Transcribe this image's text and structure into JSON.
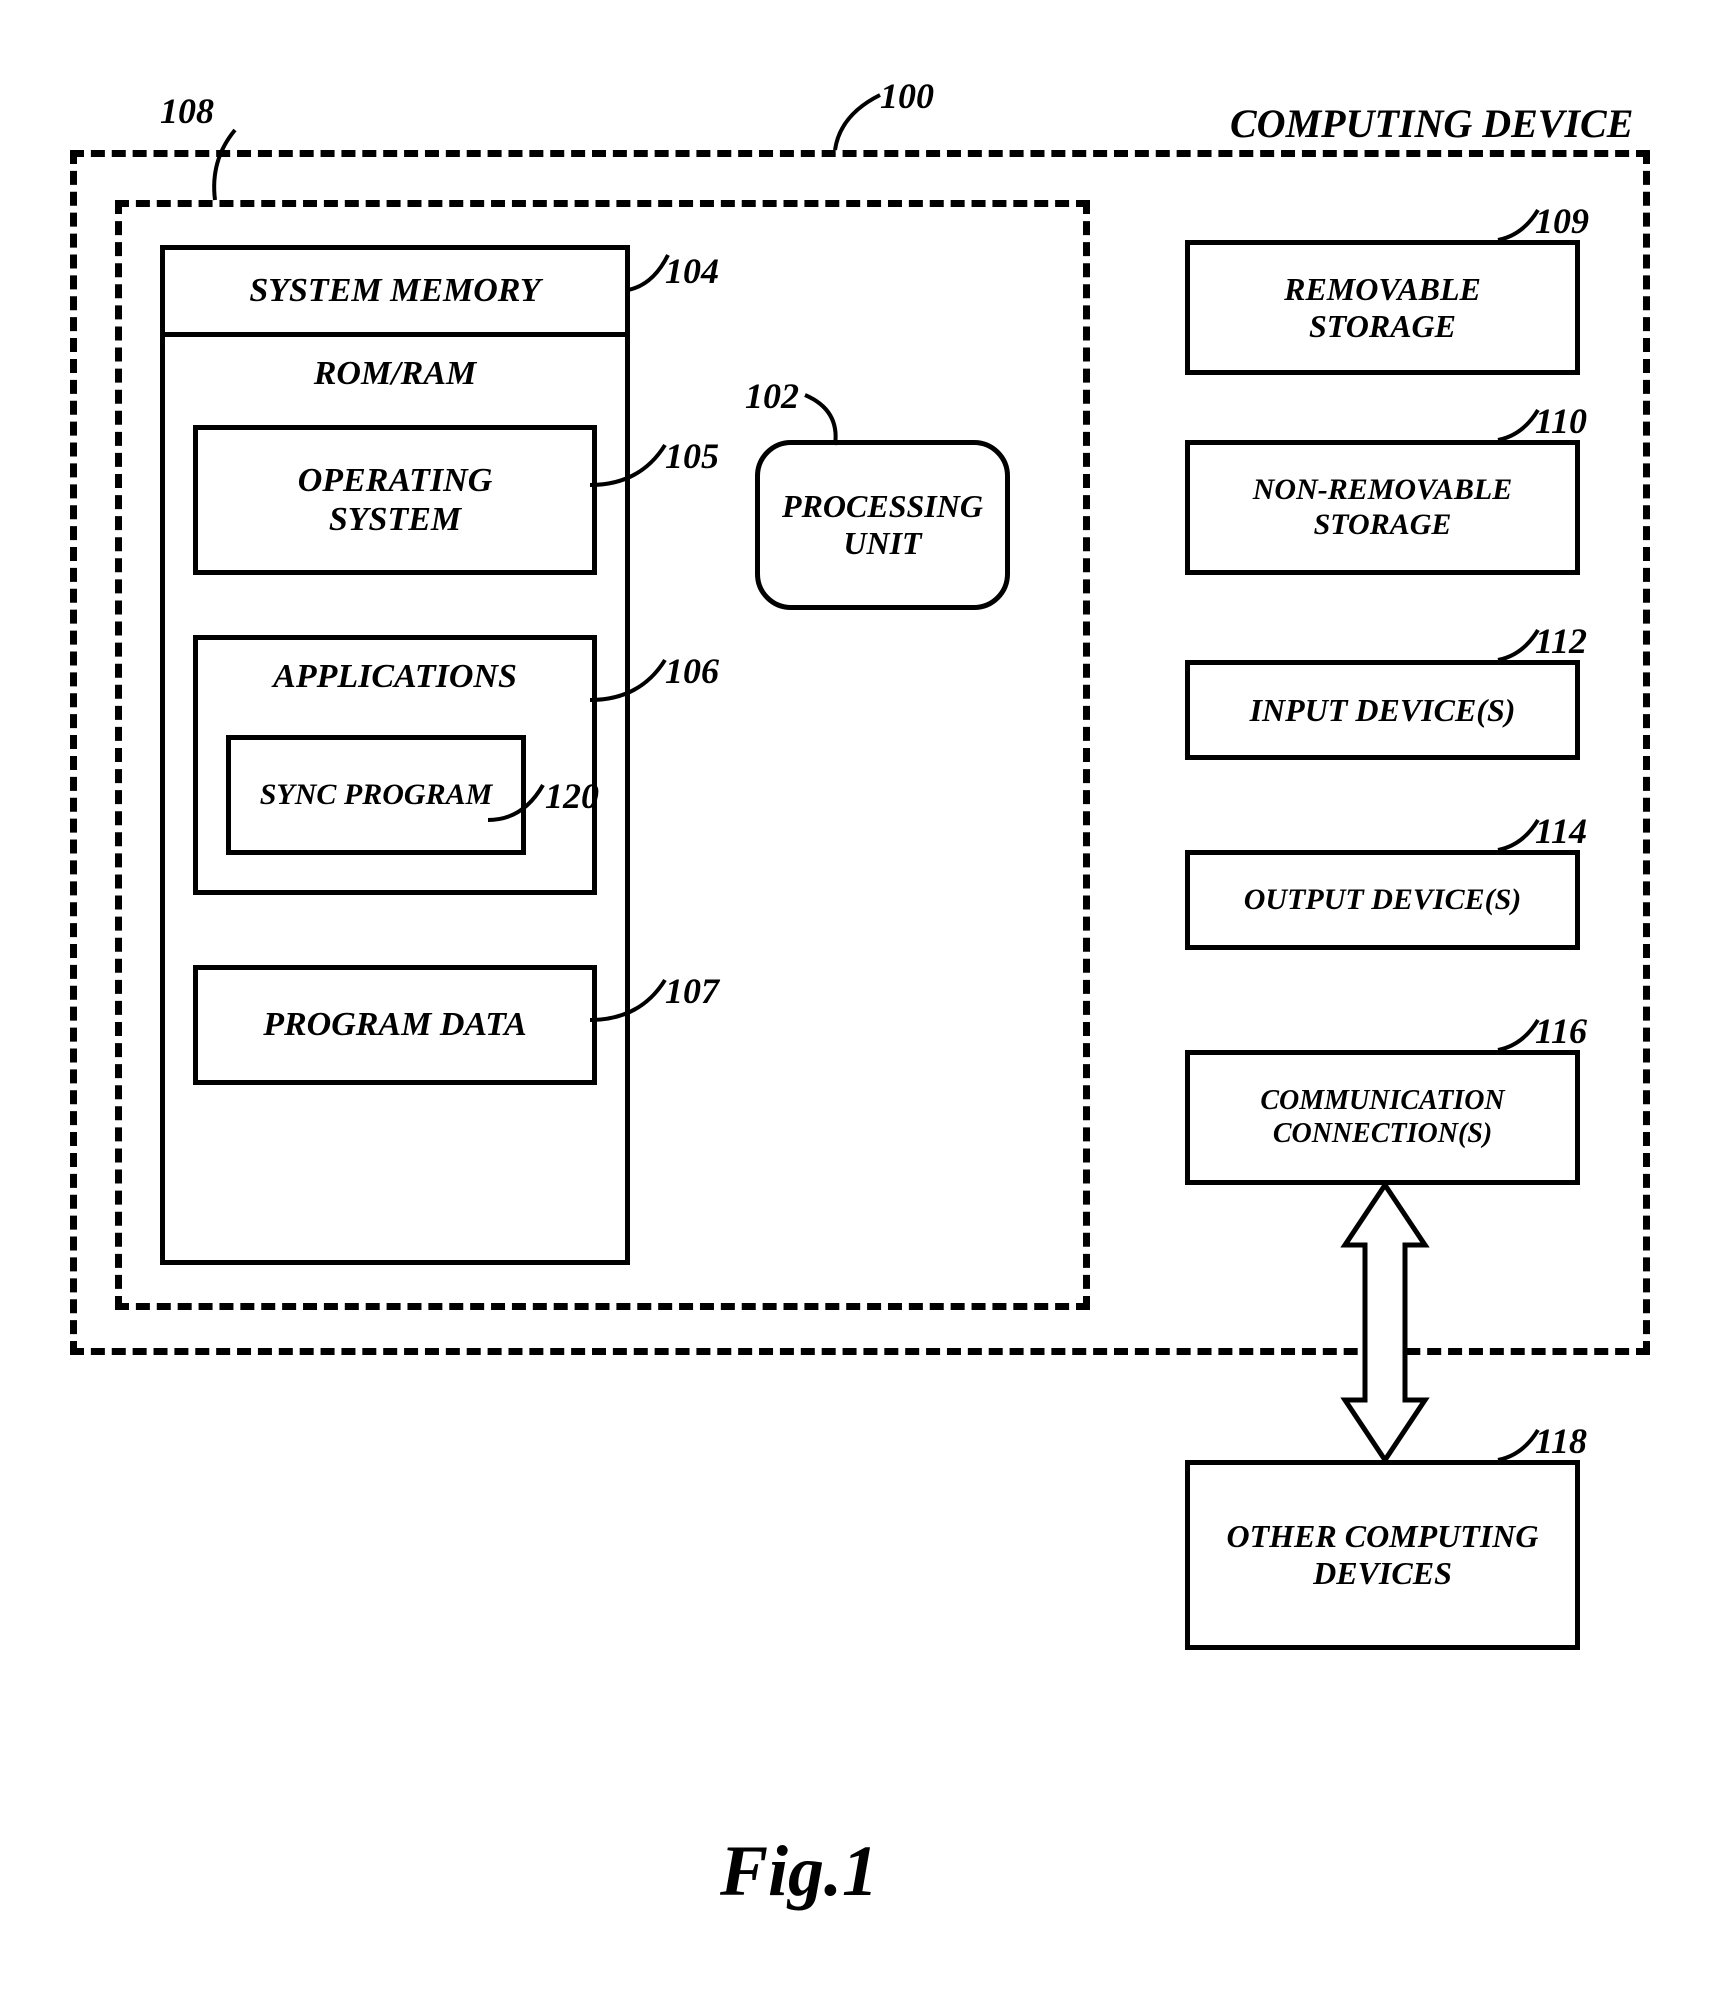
{
  "title": "COMPUTING DEVICE",
  "refs": {
    "r100": "100",
    "r102": "102",
    "r104": "104",
    "r105": "105",
    "r106": "106",
    "r107": "107",
    "r108": "108",
    "r109": "109",
    "r110": "110",
    "r112": "112",
    "r114": "114",
    "r116": "116",
    "r118": "118",
    "r120": "120"
  },
  "blocks": {
    "system_memory": "SYSTEM MEMORY",
    "rom_ram": "ROM/RAM",
    "operating_system": "OPERATING SYSTEM",
    "applications": "APPLICATIONS",
    "sync_program": "SYNC PROGRAM",
    "program_data": "PROGRAM DATA",
    "processing_unit": "PROCESSING UNIT",
    "removable_storage": "REMOVABLE STORAGE",
    "non_removable_storage": "NON-REMOVABLE STORAGE",
    "input_devices": "INPUT DEVICE(S)",
    "output_devices": "OUTPUT DEVICE(S)",
    "communication_connections": "COMMUNICATION CONNECTION(S)",
    "other_computing_devices": "OTHER COMPUTING DEVICES"
  },
  "figure": "Fig.1"
}
